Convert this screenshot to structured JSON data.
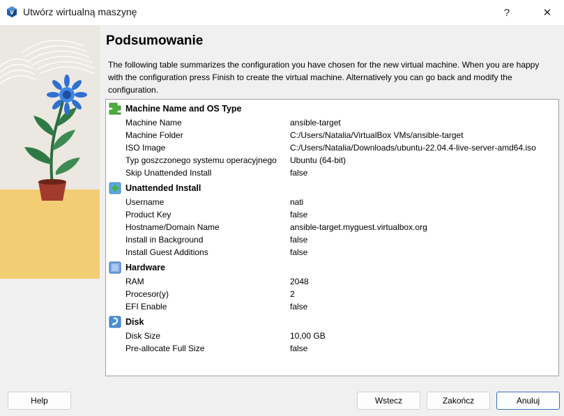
{
  "window": {
    "title": "Utwórz wirtualną maszynę",
    "help_glyph": "?",
    "close_glyph": "✕",
    "icon": "virtualbox-icon"
  },
  "page": {
    "title": "Podsumowanie",
    "description": "The following table summarizes the configuration you have chosen for the new virtual machine. When you are happy with the configuration press Finish to create the virtual machine. Alternatively you can go back and modify the configuration."
  },
  "summary": {
    "sections": [
      {
        "title": "Machine Name and OS Type",
        "icon": "puzzle-icon",
        "items": [
          {
            "key": "Machine Name",
            "value": "ansible-target"
          },
          {
            "key": "Machine Folder",
            "value": "C:/Users/Natalia/VirtualBox VMs/ansible-target"
          },
          {
            "key": "ISO Image",
            "value": "C:/Users/Natalia/Downloads/ubuntu-22.04.4-live-server-amd64.iso"
          },
          {
            "key": "Typ goszczonego systemu operacyjnego",
            "value": "Ubuntu (64-bit)"
          },
          {
            "key": "Skip Unattended Install",
            "value": "false"
          }
        ]
      },
      {
        "title": "Unattended Install",
        "icon": "plus-icon",
        "items": [
          {
            "key": "Username",
            "value": "nati"
          },
          {
            "key": "Product Key",
            "value": "false"
          },
          {
            "key": "Hostname/Domain Name",
            "value": "ansible-target.myguest.virtualbox.org"
          },
          {
            "key": "Install in Background",
            "value": "false"
          },
          {
            "key": "Install Guest Additions",
            "value": "false"
          }
        ]
      },
      {
        "title": "Hardware",
        "icon": "chip-icon",
        "items": [
          {
            "key": "RAM",
            "value": "2048"
          },
          {
            "key": "Procesor(y)",
            "value": "2"
          },
          {
            "key": "EFI Enable",
            "value": "false"
          }
        ]
      },
      {
        "title": "Disk",
        "icon": "disk-icon",
        "items": [
          {
            "key": "Disk Size",
            "value": "10,00 GB"
          },
          {
            "key": "Pre-allocate Full Size",
            "value": "false"
          }
        ]
      }
    ]
  },
  "buttons": {
    "help": "Help",
    "back": "Wstecz",
    "finish": "Zakończ",
    "cancel": "Anuluj"
  },
  "colors": {
    "accent": "#3a6fb8",
    "art_yellow": "#f3cd73",
    "flower_blue": "#2f6fd1"
  }
}
